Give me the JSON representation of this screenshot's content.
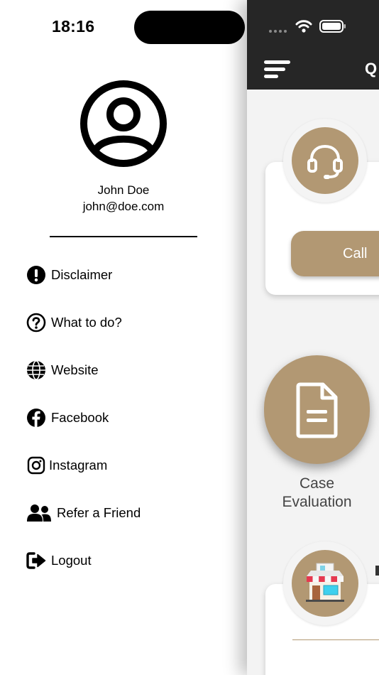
{
  "status_bar": {
    "time": "18:16"
  },
  "drawer": {
    "user": {
      "name": "John Doe",
      "email": "john@doe.com"
    },
    "menu": [
      {
        "label": "Disclaimer",
        "icon": "exclamation-circle-icon"
      },
      {
        "label": "What to do?",
        "icon": "question-circle-icon"
      },
      {
        "label": "Website",
        "icon": "globe-icon"
      },
      {
        "label": "Facebook",
        "icon": "facebook-icon"
      },
      {
        "label": "Instagram",
        "icon": "instagram-icon"
      },
      {
        "label": "Refer a Friend",
        "icon": "users-icon"
      },
      {
        "label": "Logout",
        "icon": "logout-icon"
      }
    ]
  },
  "main": {
    "header_title": "Q",
    "call_button": "Call",
    "case_evaluation": {
      "line1": "Case",
      "line2": "Evaluation"
    }
  },
  "colors": {
    "accent": "#b29873",
    "header": "#262626",
    "background": "#f3f3f3"
  }
}
